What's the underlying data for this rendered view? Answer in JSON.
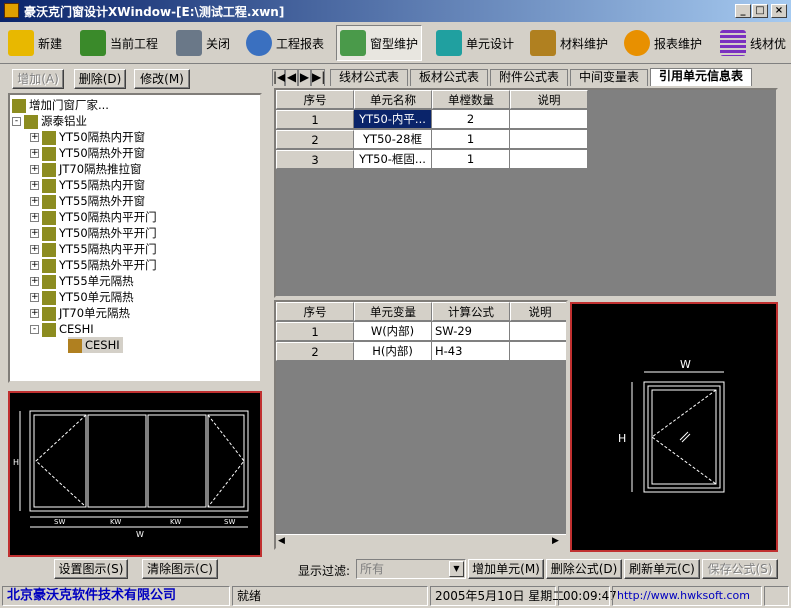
{
  "window": {
    "title": "豪沃克门窗设计XWindow-[E:\\测试工程.xwn]",
    "min": "_",
    "max": "□",
    "close": "×"
  },
  "toolbar": {
    "items": [
      {
        "label": "新建",
        "icon": "new-file-icon",
        "color": "#e8b800"
      },
      {
        "label": "当前工程",
        "icon": "project-icon",
        "color": "#3a8a2a"
      },
      {
        "label": "关闭",
        "icon": "close-project-icon",
        "color": "#6a7888"
      },
      {
        "label": "工程报表",
        "icon": "magnifier-icon",
        "color": "#3a70c0"
      },
      {
        "label": "窗型维护",
        "icon": "window-type-icon",
        "color": "#4a9a4a"
      },
      {
        "label": "单元设计",
        "icon": "unit-design-icon",
        "color": "#20a0a0"
      },
      {
        "label": "材料维护",
        "icon": "material-icon",
        "color": "#b08020"
      },
      {
        "label": "报表维护",
        "icon": "gear-icon",
        "color": "#e89000"
      },
      {
        "label": "线材优",
        "icon": "lines-icon",
        "color": "#7a30c0"
      }
    ]
  },
  "left_buttons": {
    "add": "增加(A)",
    "delete": "删除(D)",
    "modify": "修改(M)"
  },
  "tree": {
    "nodes": [
      {
        "label": "增加门窗厂家...",
        "level": 0,
        "exp": ""
      },
      {
        "label": "源泰铝业",
        "level": 0,
        "exp": "-"
      },
      {
        "label": "YT50隔热内开窗",
        "level": 1,
        "exp": "+"
      },
      {
        "label": "YT50隔热外开窗",
        "level": 1,
        "exp": "+"
      },
      {
        "label": "JT70隔热推拉窗",
        "level": 1,
        "exp": "+"
      },
      {
        "label": "YT55隔热内开窗",
        "level": 1,
        "exp": "+"
      },
      {
        "label": "YT55隔热外开窗",
        "level": 1,
        "exp": "+"
      },
      {
        "label": "YT50隔热内平开门",
        "level": 1,
        "exp": "+"
      },
      {
        "label": "YT50隔热外平开门",
        "level": 1,
        "exp": "+"
      },
      {
        "label": "YT55隔热内平开门",
        "level": 1,
        "exp": "+"
      },
      {
        "label": "YT55隔热外平开门",
        "level": 1,
        "exp": "+"
      },
      {
        "label": "YT55单元隔热",
        "level": 1,
        "exp": "+"
      },
      {
        "label": "YT50单元隔热",
        "level": 1,
        "exp": "+"
      },
      {
        "label": "JT70单元隔热",
        "level": 1,
        "exp": "+"
      },
      {
        "label": "CESHI",
        "level": 1,
        "exp": "-"
      },
      {
        "label": "CESHI",
        "level": 2,
        "exp": ""
      }
    ]
  },
  "left_preview": {
    "dims": [
      "SW",
      "KW",
      "KW",
      "SW"
    ],
    "width": "W",
    "height": "H"
  },
  "bottom_left_buttons": {
    "set_image": "设置图示(S)",
    "clear_image": "清除图示(C)"
  },
  "tabs": {
    "nav": [
      "|◀",
      "◀",
      "▶",
      "▶|"
    ],
    "items": [
      "线材公式表",
      "板材公式表",
      "附件公式表",
      "中间变量表",
      "引用单元信息表"
    ],
    "active": 4
  },
  "unit_table": {
    "headers": [
      "序号",
      "单元名称",
      "单樘数量",
      "说明"
    ],
    "rows": [
      [
        "1",
        "YT50-内平...",
        "2",
        ""
      ],
      [
        "2",
        "YT50-28框",
        "1",
        ""
      ],
      [
        "3",
        "YT50-框固...",
        "1",
        ""
      ]
    ]
  },
  "var_table": {
    "headers": [
      "序号",
      "单元变量",
      "计算公式",
      "说明"
    ],
    "rows": [
      [
        "1",
        "W(内部)",
        "SW-29",
        ""
      ],
      [
        "2",
        "H(内部)",
        "H-43",
        ""
      ]
    ]
  },
  "right_preview": {
    "width": "W",
    "height": "H"
  },
  "bottom_bar": {
    "filter_label": "显示过滤:",
    "filter_value": "所有",
    "add_unit": "增加单元(M)",
    "delete_formula": "删除公式(D)",
    "refresh_unit": "刷新单元(C)",
    "save_formula": "保存公式(S)"
  },
  "status": {
    "company": "北京豪沃克软件技术有限公司",
    "state": "就绪",
    "date": "2005年5月10日 星期二",
    "time": "00:09:47",
    "url": "http://www.hwksoft.com"
  }
}
